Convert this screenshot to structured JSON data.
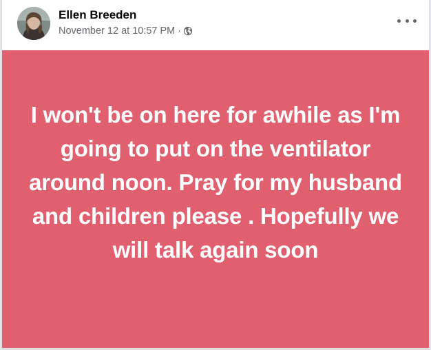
{
  "post": {
    "author_name": "Ellen Breeden",
    "timestamp": "November 12 at 10:57 PM",
    "separator": "·",
    "privacy_icon": "globe-icon",
    "menu_icon": "more-options-icon",
    "text": "I won't be on here for awhile as I'm going to put on the ventilator around noon. Pray for my husband and children please . Hopefully we will talk again soon",
    "background_color": "#e0606f"
  }
}
